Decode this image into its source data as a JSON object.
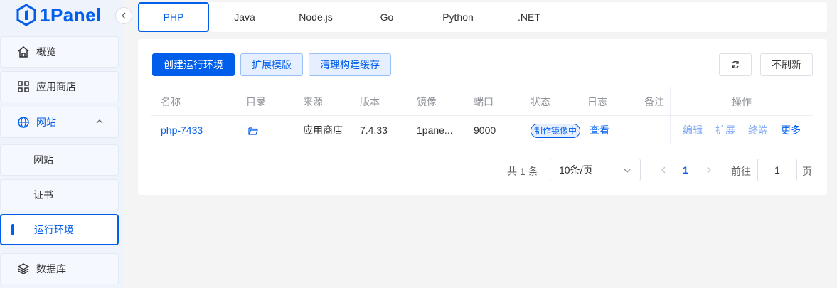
{
  "brand": {
    "name": "1Panel",
    "color": "#005eeb"
  },
  "sidebar": {
    "items": [
      {
        "label": "概览",
        "icon": "home-icon"
      },
      {
        "label": "应用商店",
        "icon": "grid-icon"
      },
      {
        "label": "网站",
        "icon": "globe-icon",
        "expanded": true
      },
      {
        "label": "网站",
        "sub": true
      },
      {
        "label": "证书",
        "sub": true
      },
      {
        "label": "运行环境",
        "sub": true,
        "active": true
      },
      {
        "label": "数据库",
        "icon": "layers-icon"
      }
    ]
  },
  "tabs": [
    "PHP",
    "Java",
    "Node.js",
    "Go",
    "Python",
    ".NET"
  ],
  "active_tab": "PHP",
  "toolbar": {
    "create_label": "创建运行环境",
    "extension_label": "扩展模版",
    "clean_label": "清理构建缓存",
    "no_refresh_label": "不刷新"
  },
  "table": {
    "headers": [
      "名称",
      "目录",
      "来源",
      "版本",
      "镜像",
      "端口",
      "状态",
      "日志",
      "备注",
      "操作"
    ],
    "rows": [
      {
        "name": "php-7433",
        "source": "应用商店",
        "version": "7.4.33",
        "image": "1pane...",
        "port": "9000",
        "status": "制作镜像中",
        "log": "查看",
        "remark": "",
        "ops": [
          "编辑",
          "扩展",
          "终端",
          "更多"
        ]
      }
    ]
  },
  "pagination": {
    "total_text": "共 1 条",
    "page_size": "10条/页",
    "current_page": "1",
    "goto_label": "前往",
    "goto_value": "1",
    "goto_suffix": "页"
  }
}
